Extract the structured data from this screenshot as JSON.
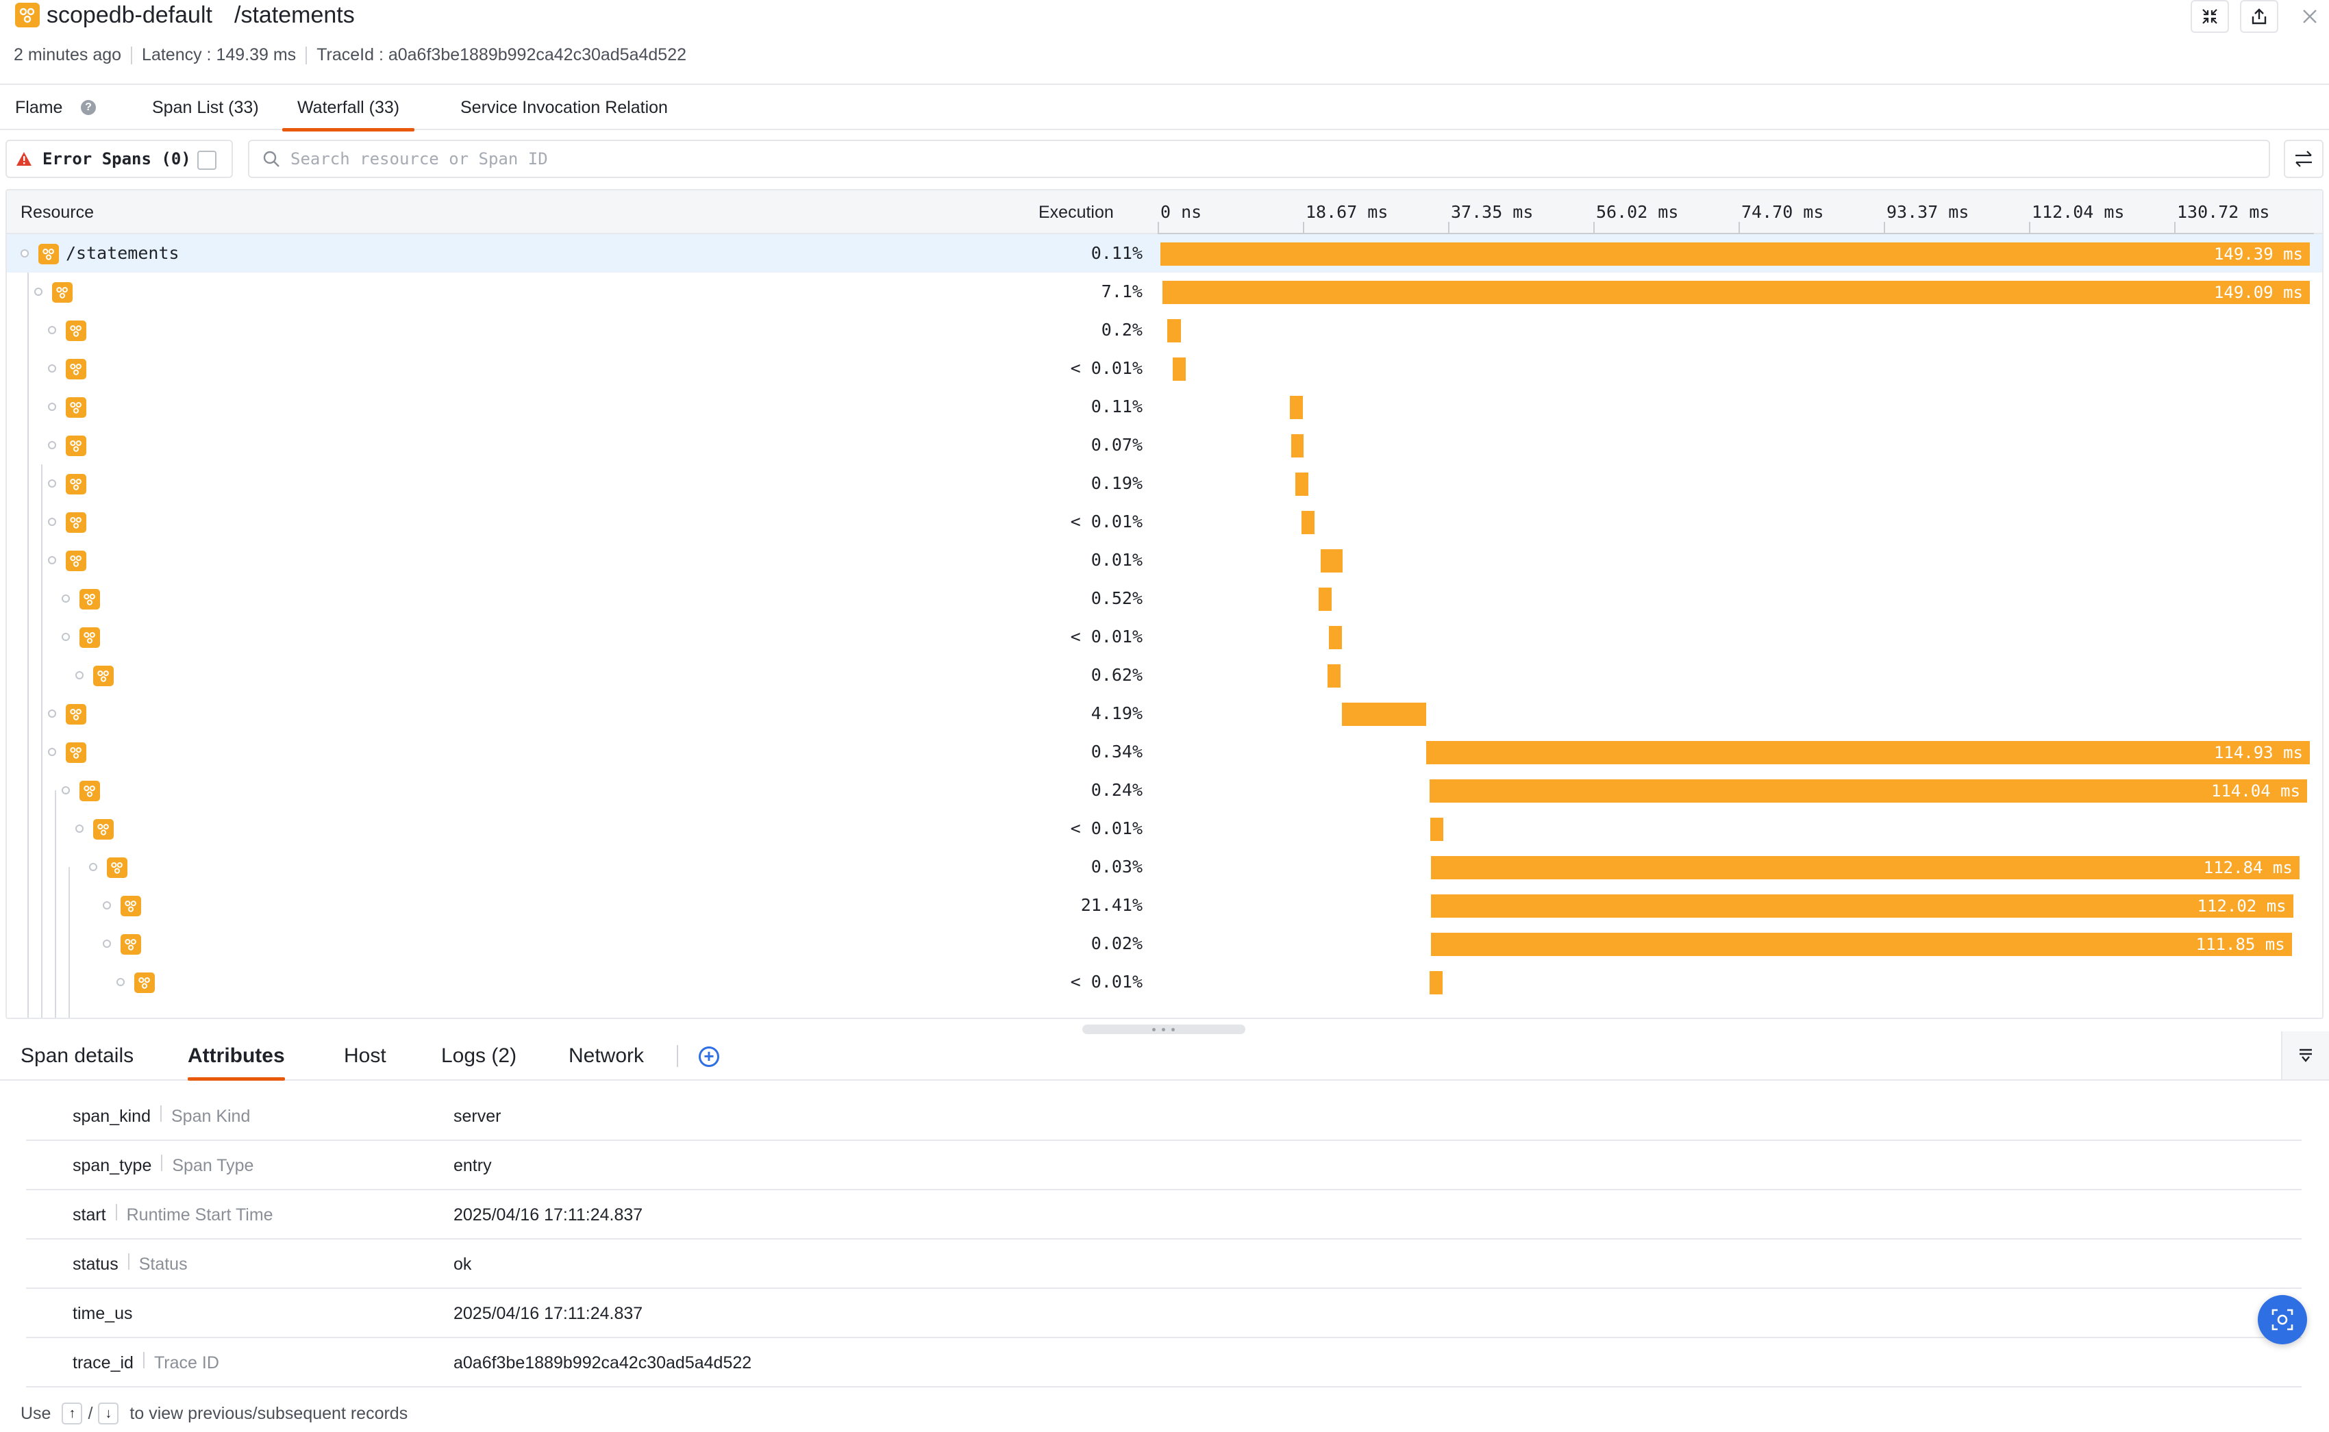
{
  "header": {
    "service_name": "scopedb-default",
    "endpoint": "/statements",
    "time_ago": "2 minutes ago",
    "latency": "Latency : 149.39 ms",
    "trace_id": "TraceId : a0a6f3be1889b992ca42c30ad5a4d522"
  },
  "tabs": [
    {
      "label": "Flame"
    },
    {
      "label": "Span List (33)"
    },
    {
      "label": "Waterfall (33)"
    },
    {
      "label": "Service Invocation Relation"
    }
  ],
  "active_tab": "Waterfall (33)",
  "filter": {
    "error_spans_label": "Error Spans (0)",
    "error_spans_checked": false,
    "search_placeholder": "Search resource or Span ID",
    "search_value": ""
  },
  "waterfall": {
    "col_resource": "Resource",
    "col_execution": "Execution",
    "axis_ticks": [
      "0 ns",
      "18.67 ms",
      "37.35 ms",
      "56.02 ms",
      "74.70 ms",
      "93.37 ms",
      "112.04 ms",
      "130.72 ms"
    ],
    "axis_max_ms": 149.39,
    "accent_color": "#faa728",
    "rows": [
      {
        "name": "/statements",
        "depth": 0,
        "exec": "0.11%",
        "start_ms": 0.0,
        "dur_ms": 149.39,
        "label": "149.39 ms",
        "selected": true
      },
      {
        "name": "",
        "depth": 1,
        "exec": "7.1%",
        "start_ms": 0.3,
        "dur_ms": 149.09,
        "label": "149.09 ms"
      },
      {
        "name": "",
        "depth": 2,
        "exec": "0.2%",
        "start_ms": 0.9,
        "dur_ms": 1.8,
        "label": ""
      },
      {
        "name": "",
        "depth": 2,
        "exec": "< 0.01%",
        "start_ms": 1.6,
        "dur_ms": 1.7,
        "label": ""
      },
      {
        "name": "",
        "depth": 2,
        "exec": "0.11%",
        "start_ms": 16.8,
        "dur_ms": 1.7,
        "label": ""
      },
      {
        "name": "",
        "depth": 2,
        "exec": "0.07%",
        "start_ms": 17.0,
        "dur_ms": 1.6,
        "label": ""
      },
      {
        "name": "",
        "depth": 2,
        "exec": "0.19%",
        "start_ms": 17.5,
        "dur_ms": 1.7,
        "label": ""
      },
      {
        "name": "",
        "depth": 2,
        "exec": "< 0.01%",
        "start_ms": 18.3,
        "dur_ms": 1.7,
        "label": ""
      },
      {
        "name": "",
        "depth": 2,
        "exec": "0.01%",
        "start_ms": 20.8,
        "dur_ms": 2.9,
        "label": ""
      },
      {
        "name": "",
        "depth": 3,
        "exec": "0.52%",
        "start_ms": 20.6,
        "dur_ms": 1.7,
        "label": ""
      },
      {
        "name": "",
        "depth": 3,
        "exec": "< 0.01%",
        "start_ms": 21.9,
        "dur_ms": 1.7,
        "label": ""
      },
      {
        "name": "",
        "depth": 4,
        "exec": "0.62%",
        "start_ms": 21.7,
        "dur_ms": 1.7,
        "label": ""
      },
      {
        "name": "",
        "depth": 2,
        "exec": "4.19%",
        "start_ms": 23.6,
        "dur_ms": 10.9,
        "label": ""
      },
      {
        "name": "",
        "depth": 2,
        "exec": "0.34%",
        "start_ms": 34.5,
        "dur_ms": 114.93,
        "label": "114.93 ms"
      },
      {
        "name": "",
        "depth": 3,
        "exec": "0.24%",
        "start_ms": 35.0,
        "dur_ms": 114.04,
        "label": "114.04 ms"
      },
      {
        "name": "",
        "depth": 4,
        "exec": "< 0.01%",
        "start_ms": 35.1,
        "dur_ms": 1.7,
        "label": ""
      },
      {
        "name": "",
        "depth": 5,
        "exec": "0.03%",
        "start_ms": 35.2,
        "dur_ms": 112.84,
        "label": "112.84 ms"
      },
      {
        "name": "",
        "depth": 6,
        "exec": "21.41%",
        "start_ms": 35.2,
        "dur_ms": 112.02,
        "label": "112.02 ms"
      },
      {
        "name": "",
        "depth": 6,
        "exec": "0.02%",
        "start_ms": 35.2,
        "dur_ms": 111.85,
        "label": "111.85 ms"
      },
      {
        "name": "",
        "depth": 7,
        "exec": "< 0.01%",
        "start_ms": 35.0,
        "dur_ms": 1.7,
        "label": ""
      }
    ]
  },
  "detail_tabs": [
    {
      "label": "Span details"
    },
    {
      "label": "Attributes"
    },
    {
      "label": "Host"
    },
    {
      "label": "Logs (2)"
    },
    {
      "label": "Network"
    }
  ],
  "active_detail_tab": "Attributes",
  "attributes": [
    {
      "key": "span_kind",
      "desc": "Span Kind",
      "value": "server"
    },
    {
      "key": "span_type",
      "desc": "Span Type",
      "value": "entry"
    },
    {
      "key": "start",
      "desc": "Runtime Start Time",
      "value": "2025/04/16 17:11:24.837"
    },
    {
      "key": "status",
      "desc": "Status",
      "value": "ok"
    },
    {
      "key": "time_us",
      "desc": "",
      "value": "2025/04/16 17:11:24.837"
    },
    {
      "key": "trace_id",
      "desc": "Trace ID",
      "value": "a0a6f3be1889b992ca42c30ad5a4d522"
    }
  ],
  "footer": {
    "prefix": "Use",
    "key_up": "↑",
    "slash": "/",
    "key_down": "↓",
    "suffix": "to view previous/subsequent records"
  }
}
